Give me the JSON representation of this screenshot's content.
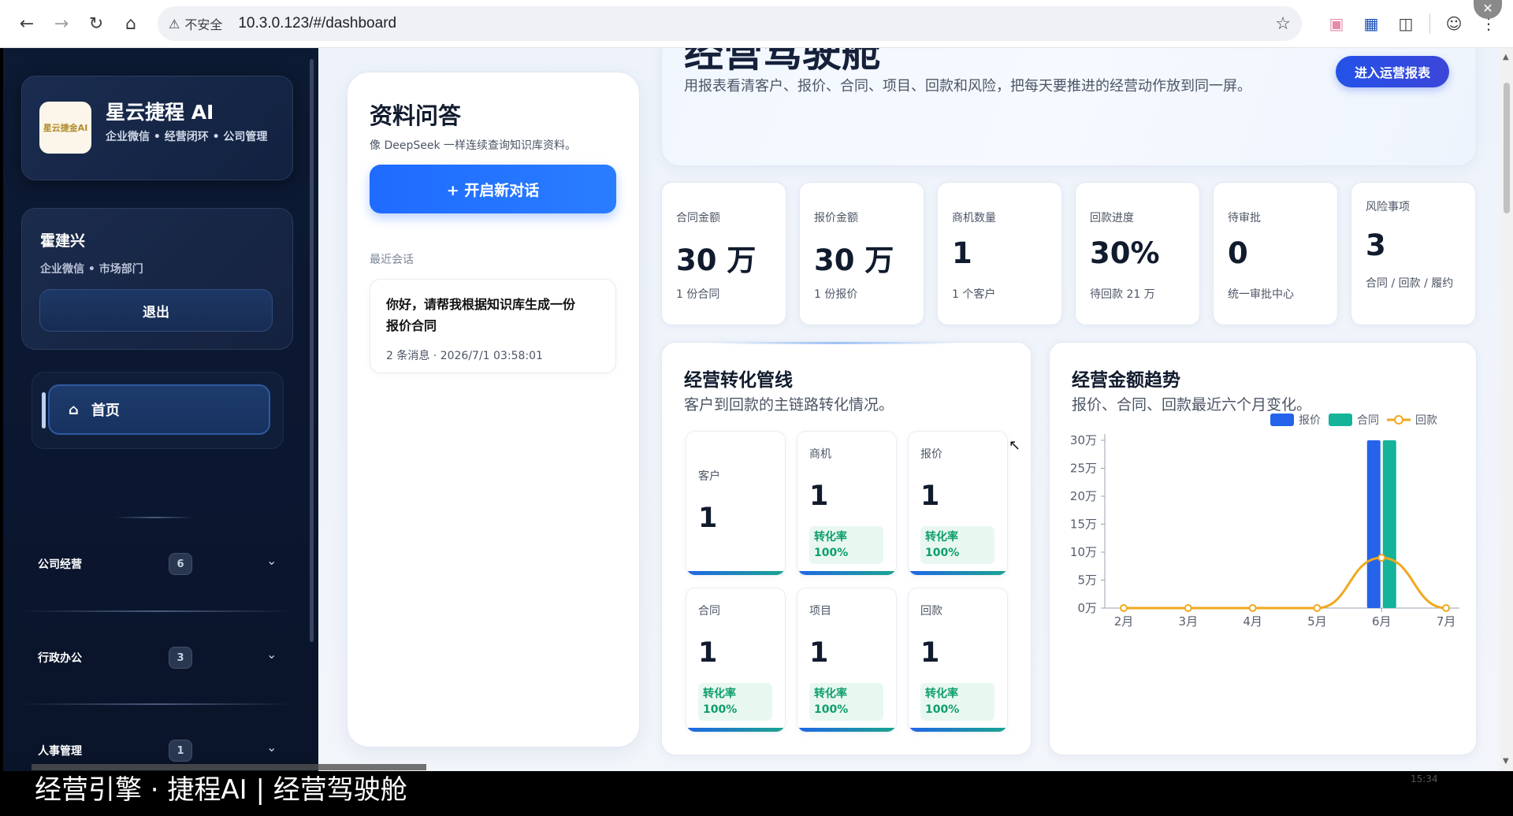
{
  "browser": {
    "warning": "不安全",
    "url": "10.3.0.123/#/dashboard"
  },
  "sidebar": {
    "brand_name": "星云捷程 AI",
    "brand_sub": "企业微信 • 经营闭环 • 公司管理",
    "logo_text": "星云捷金AI",
    "user_name": "霍建兴",
    "user_dept": "企业微信 • 市场部门",
    "logout_label": "退出",
    "nav_home": "首页",
    "groups": [
      {
        "label": "公司经营",
        "count": "6"
      },
      {
        "label": "行政办公",
        "count": "3"
      },
      {
        "label": "人事管理",
        "count": "1"
      }
    ]
  },
  "qa": {
    "title": "资料问答",
    "subtitle": "像 DeepSeek 一样连续查询知识库资料。",
    "new_chat": "+ 开启新对话",
    "recent_label": "最近会话",
    "session_title": "你好，请帮我根据知识库生成一份报价合同",
    "session_meta": "2 条消息 · 2026/7/1 03:58:01"
  },
  "hero": {
    "title": "经营驾驶舱",
    "desc": "用报表看清客户、报价、合同、项目、回款和风险，把每天要推进的经营动作放到同一屏。",
    "report_button": "进入运营报表"
  },
  "kpis": [
    {
      "label": "合同金额",
      "value": "30 万",
      "note": "1 份合同"
    },
    {
      "label": "报价金额",
      "value": "30 万",
      "note": "1 份报价"
    },
    {
      "label": "商机数量",
      "value": "1",
      "note": "1 个客户"
    },
    {
      "label": "回款进度",
      "value": "30%",
      "note": "待回款 21 万"
    },
    {
      "label": "待审批",
      "value": "0",
      "note": "统一审批中心"
    },
    {
      "label": "风险事项",
      "value": "3",
      "note": "合同 / 回款 / 履约"
    }
  ],
  "pipeline": {
    "title": "经营转化管线",
    "subtitle": "客户到回款的主链路转化情况。",
    "rate_label": "转化率",
    "stages": [
      {
        "label": "客户",
        "value": "1",
        "rate": ""
      },
      {
        "label": "商机",
        "value": "1",
        "rate": "100%"
      },
      {
        "label": "报价",
        "value": "1",
        "rate": "100%"
      },
      {
        "label": "合同",
        "value": "1",
        "rate": "100%"
      },
      {
        "label": "项目",
        "value": "1",
        "rate": "100%"
      },
      {
        "label": "回款",
        "value": "1",
        "rate": "100%"
      }
    ]
  },
  "trend": {
    "title": "经营金额趋势",
    "subtitle": "报价、合同、回款最近六个月变化。"
  },
  "chart_data": {
    "type": "bar",
    "categories": [
      "2月",
      "3月",
      "4月",
      "5月",
      "6月",
      "7月"
    ],
    "y_tick_labels": [
      "0万",
      "5万",
      "10万",
      "15万",
      "20万",
      "25万",
      "30万"
    ],
    "ylim": [
      0,
      30
    ],
    "series": [
      {
        "name": "报价",
        "kind": "bar",
        "color": "#2563eb",
        "values": [
          0,
          0,
          0,
          0,
          30,
          0
        ]
      },
      {
        "name": "合同",
        "kind": "bar",
        "color": "#14b39a",
        "values": [
          0,
          0,
          0,
          0,
          30,
          0
        ]
      },
      {
        "name": "回款",
        "kind": "line",
        "color": "#f0a81e",
        "values": [
          0,
          0,
          0,
          0,
          9,
          0
        ]
      }
    ],
    "legend": "top-right",
    "grid": false
  },
  "overlay": {
    "caption": "经营引擎 · 捷程AI | 经营驾驶舱",
    "clock": "15:34"
  },
  "colors": {
    "sidebar_bg": "#0d1a33",
    "accent": "#1f6bff",
    "success": "#0e9e6c"
  }
}
